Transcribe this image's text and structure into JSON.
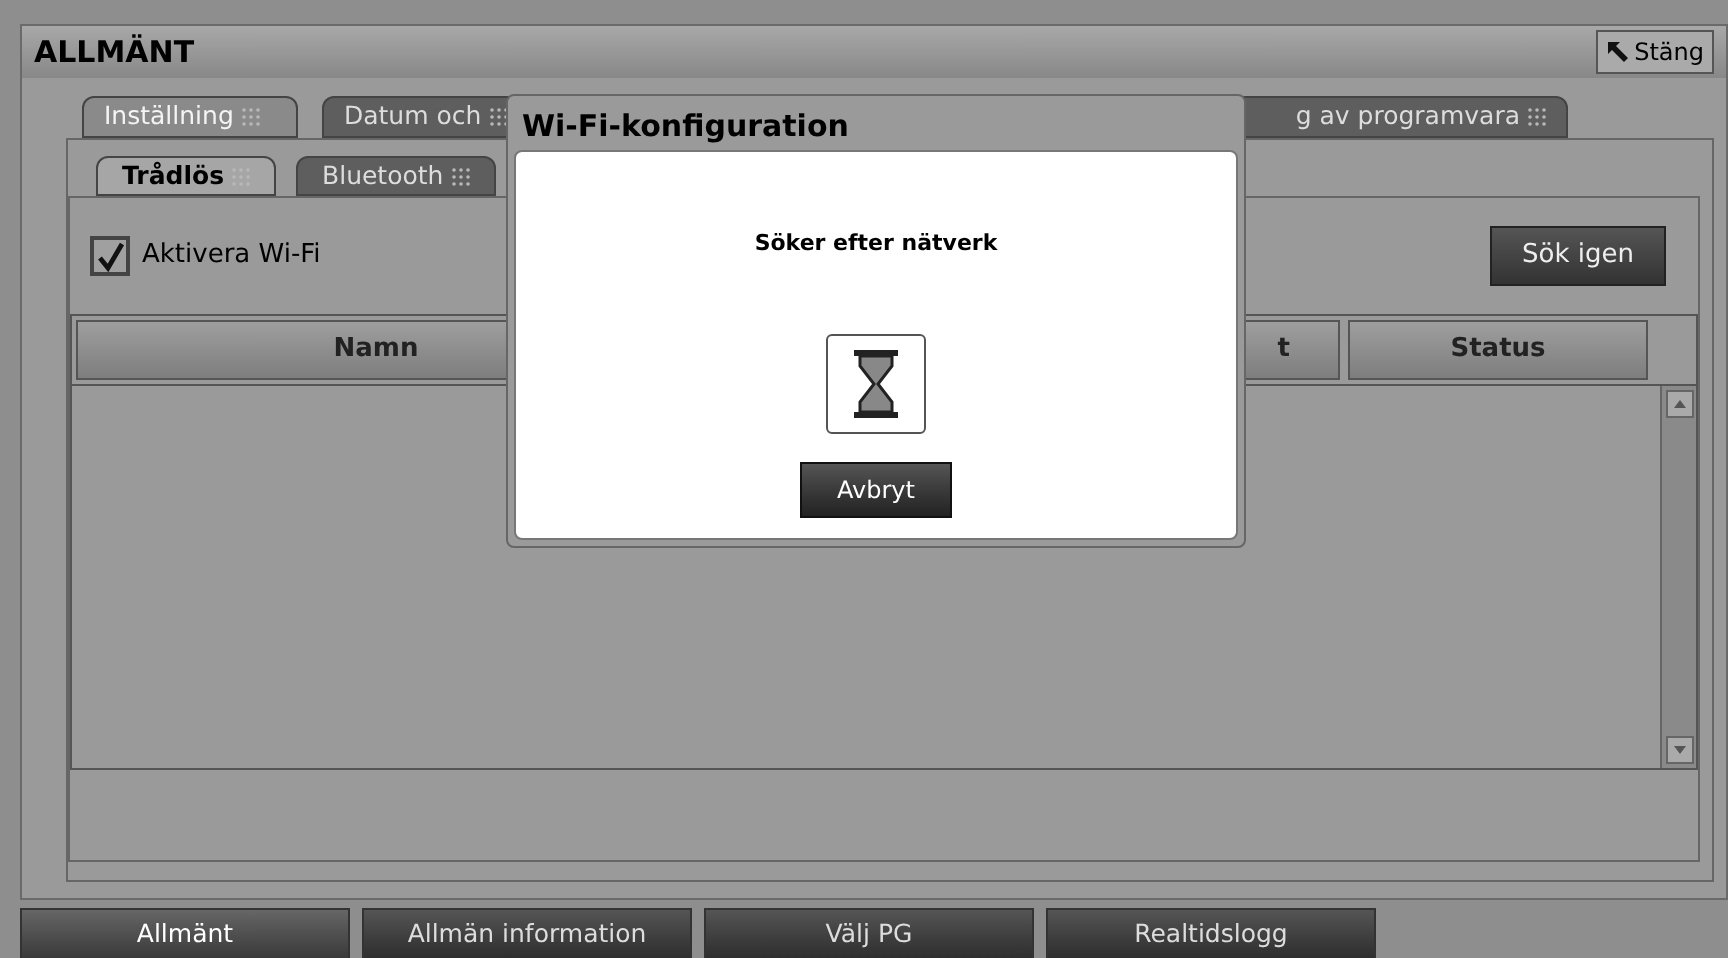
{
  "window": {
    "title": "ALLMÄNT"
  },
  "close_button": {
    "label": "Stäng"
  },
  "tabs": [
    {
      "label": "Inställning",
      "selected": true
    },
    {
      "label": "Datum och",
      "selected": false
    },
    {
      "label": "g av programvara",
      "selected": false
    }
  ],
  "subtabs": [
    {
      "label": "Trådlös",
      "selected": true
    },
    {
      "label": "Bluetooth",
      "selected": false
    }
  ],
  "wifi_toggle": {
    "label": "Aktivera Wi-Fi",
    "checked": true
  },
  "search_again_button": {
    "label": "Sök igen"
  },
  "table": {
    "columns": [
      "Namn",
      "t",
      "Status"
    ]
  },
  "dialog": {
    "title": "Wi-Fi-konfiguration",
    "message": "Söker efter nätverk",
    "cancel_button": {
      "label": "Avbryt"
    }
  },
  "bottom_tabs": [
    {
      "label": "Allmänt",
      "selected": true
    },
    {
      "label": "Allmän information",
      "selected": false
    },
    {
      "label": "Välj PG",
      "selected": false
    },
    {
      "label": "Realtidslogg",
      "selected": false
    }
  ]
}
